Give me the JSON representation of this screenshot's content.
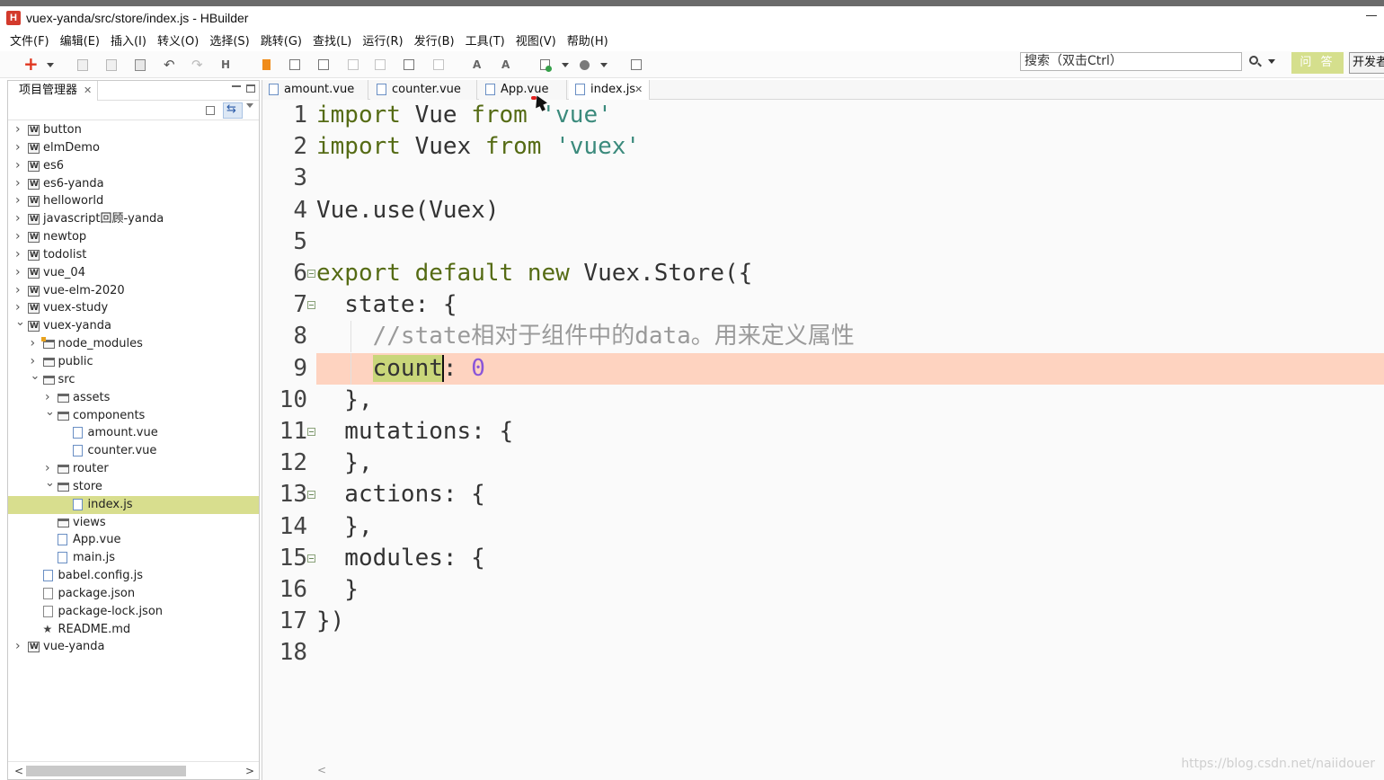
{
  "window": {
    "title": "vuex-yanda/src/store/index.js  -  HBuilder",
    "logo_letter": "H"
  },
  "menu": [
    "文件(F)",
    "编辑(E)",
    "插入(I)",
    "转义(O)",
    "选择(S)",
    "跳转(G)",
    "查找(L)",
    "运行(R)",
    "发行(B)",
    "工具(T)",
    "视图(V)",
    "帮助(H)"
  ],
  "search": {
    "placeholder": "搜索（双击Ctrl）"
  },
  "buttons": {
    "ask": "问 答",
    "dev": "开发者"
  },
  "project_panel": {
    "tab_label": "项目管理器",
    "tree": [
      {
        "label": "button",
        "type": "project",
        "depth": 0,
        "twisty": "closed"
      },
      {
        "label": "elmDemo",
        "type": "project",
        "depth": 0,
        "twisty": "closed"
      },
      {
        "label": "es6",
        "type": "project",
        "depth": 0,
        "twisty": "closed"
      },
      {
        "label": "es6-yanda",
        "type": "project",
        "depth": 0,
        "twisty": "closed"
      },
      {
        "label": "helloworld",
        "type": "project",
        "depth": 0,
        "twisty": "closed"
      },
      {
        "label": "javascript回顾-yanda",
        "type": "project",
        "depth": 0,
        "twisty": "closed"
      },
      {
        "label": "newtop",
        "type": "project",
        "depth": 0,
        "twisty": "closed"
      },
      {
        "label": "todolist",
        "type": "project",
        "depth": 0,
        "twisty": "closed"
      },
      {
        "label": "vue_04",
        "type": "project",
        "depth": 0,
        "twisty": "closed"
      },
      {
        "label": "vue-elm-2020",
        "type": "project",
        "depth": 0,
        "twisty": "closed"
      },
      {
        "label": "vuex-study",
        "type": "project",
        "depth": 0,
        "twisty": "closed"
      },
      {
        "label": "vuex-yanda",
        "type": "project",
        "depth": 0,
        "twisty": "open"
      },
      {
        "label": "node_modules",
        "type": "nodefolder",
        "depth": 1,
        "twisty": "closed"
      },
      {
        "label": "public",
        "type": "folder",
        "depth": 1,
        "twisty": "closed"
      },
      {
        "label": "src",
        "type": "folder",
        "depth": 1,
        "twisty": "open"
      },
      {
        "label": "assets",
        "type": "folder",
        "depth": 2,
        "twisty": "closed"
      },
      {
        "label": "components",
        "type": "folder",
        "depth": 2,
        "twisty": "open"
      },
      {
        "label": "amount.vue",
        "type": "file",
        "depth": 3,
        "twisty": "none"
      },
      {
        "label": "counter.vue",
        "type": "file",
        "depth": 3,
        "twisty": "none"
      },
      {
        "label": "router",
        "type": "folder",
        "depth": 2,
        "twisty": "closed"
      },
      {
        "label": "store",
        "type": "folder",
        "depth": 2,
        "twisty": "open"
      },
      {
        "label": "index.js",
        "type": "file",
        "depth": 3,
        "twisty": "none",
        "selected": true
      },
      {
        "label": "views",
        "type": "folder",
        "depth": 2,
        "twisty": "none"
      },
      {
        "label": "App.vue",
        "type": "file",
        "depth": 2,
        "twisty": "none"
      },
      {
        "label": "main.js",
        "type": "file",
        "depth": 2,
        "twisty": "none"
      },
      {
        "label": "babel.config.js",
        "type": "file",
        "depth": 1,
        "twisty": "none"
      },
      {
        "label": "package.json",
        "type": "json",
        "depth": 1,
        "twisty": "none"
      },
      {
        "label": "package-lock.json",
        "type": "json",
        "depth": 1,
        "twisty": "none"
      },
      {
        "label": "README.md",
        "type": "star",
        "depth": 1,
        "twisty": "none"
      },
      {
        "label": "vue-yanda",
        "type": "project",
        "depth": 0,
        "twisty": "closed"
      }
    ]
  },
  "editor": {
    "tabs": [
      {
        "label": "amount.vue",
        "active": false,
        "closable": false
      },
      {
        "label": "counter.vue",
        "active": false,
        "closable": false
      },
      {
        "label": "App.vue",
        "active": false,
        "closable": false
      },
      {
        "label": "index.js",
        "active": true,
        "closable": true
      }
    ],
    "current_line": 9,
    "lines": [
      {
        "n": "1",
        "fold": false,
        "tokens": [
          [
            "kw",
            "import"
          ],
          [
            "txt",
            " Vue "
          ],
          [
            "kw",
            "from"
          ],
          [
            "txt",
            " "
          ],
          [
            "str",
            "'vue'"
          ]
        ]
      },
      {
        "n": "2",
        "fold": false,
        "tokens": [
          [
            "kw",
            "import"
          ],
          [
            "txt",
            " Vuex "
          ],
          [
            "kw",
            "from"
          ],
          [
            "txt",
            " "
          ],
          [
            "str",
            "'vuex'"
          ]
        ]
      },
      {
        "n": "3",
        "fold": false,
        "tokens": []
      },
      {
        "n": "4",
        "fold": false,
        "tokens": [
          [
            "txt",
            "Vue.use(Vuex)"
          ]
        ]
      },
      {
        "n": "5",
        "fold": false,
        "tokens": []
      },
      {
        "n": "6",
        "fold": true,
        "tokens": [
          [
            "kw",
            "export"
          ],
          [
            "txt",
            " "
          ],
          [
            "kw",
            "default"
          ],
          [
            "txt",
            " "
          ],
          [
            "kw",
            "new"
          ],
          [
            "txt",
            " Vuex.Store({"
          ]
        ]
      },
      {
        "n": "7",
        "fold": true,
        "tokens": [
          [
            "txt",
            "  state: {"
          ]
        ]
      },
      {
        "n": "8",
        "fold": false,
        "tokens": [
          [
            "txt",
            "    "
          ],
          [
            "cmt",
            "//state相对于组件中的data。用来定义属性"
          ]
        ]
      },
      {
        "n": "9",
        "fold": false,
        "tokens": [
          [
            "txt",
            "    "
          ],
          [
            "hl",
            "count"
          ],
          [
            "txt",
            ": "
          ],
          [
            "num",
            "0"
          ]
        ]
      },
      {
        "n": "10",
        "fold": false,
        "tokens": [
          [
            "txt",
            "  },"
          ]
        ]
      },
      {
        "n": "11",
        "fold": true,
        "tokens": [
          [
            "txt",
            "  mutations: {"
          ]
        ]
      },
      {
        "n": "12",
        "fold": false,
        "tokens": [
          [
            "txt",
            "  },"
          ]
        ]
      },
      {
        "n": "13",
        "fold": true,
        "tokens": [
          [
            "txt",
            "  actions: {"
          ]
        ]
      },
      {
        "n": "14",
        "fold": false,
        "tokens": [
          [
            "txt",
            "  },"
          ]
        ]
      },
      {
        "n": "15",
        "fold": true,
        "tokens": [
          [
            "txt",
            "  modules: {"
          ]
        ]
      },
      {
        "n": "16",
        "fold": false,
        "tokens": [
          [
            "txt",
            "  }"
          ]
        ]
      },
      {
        "n": "17",
        "fold": false,
        "tokens": [
          [
            "txt",
            "})"
          ]
        ]
      },
      {
        "n": "18",
        "fold": false,
        "tokens": []
      }
    ]
  },
  "watermark": "https://blog.csdn.net/naiidouer"
}
